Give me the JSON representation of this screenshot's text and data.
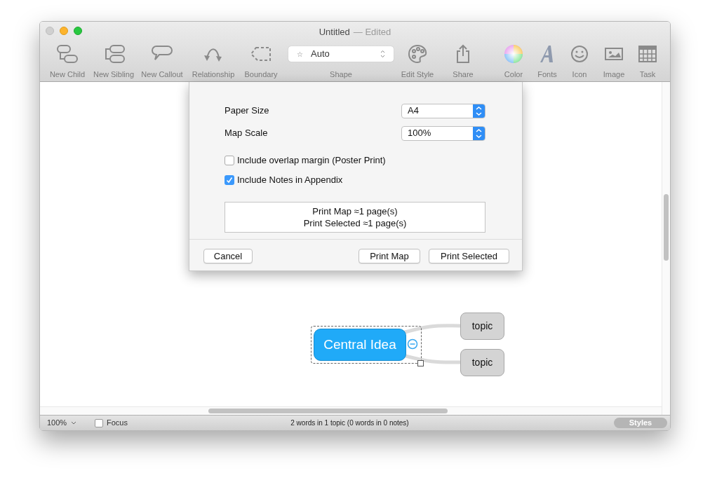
{
  "window": {
    "title": "Untitled",
    "subtitle": "— Edited"
  },
  "toolbar": [
    {
      "kind": "tool",
      "label": "New Child"
    },
    {
      "kind": "tool",
      "label": "New Sibling"
    },
    {
      "kind": "tool",
      "label": "New Callout"
    },
    {
      "kind": "tool",
      "label": "Relationship"
    },
    {
      "kind": "tool",
      "label": "Boundary"
    },
    {
      "kind": "select",
      "label": "Shape",
      "value": "Auto",
      "glyph": "☆"
    },
    {
      "kind": "tool",
      "label": "Edit Style"
    },
    {
      "kind": "tool",
      "label": "Share"
    },
    {
      "kind": "tool",
      "label": "Color"
    },
    {
      "kind": "tool",
      "label": "Fonts"
    },
    {
      "kind": "tool",
      "label": "Icon"
    },
    {
      "kind": "tool",
      "label": "Image"
    },
    {
      "kind": "tool",
      "label": "Task"
    }
  ],
  "dialog": {
    "fields": [
      {
        "label": "Paper Size",
        "value": "A4"
      },
      {
        "label": "Map Scale",
        "value": "100%"
      }
    ],
    "checkboxes": [
      {
        "label": "Include overlap margin (Poster Print)",
        "checked": false
      },
      {
        "label": "Include Notes in Appendix",
        "checked": true
      }
    ],
    "summary": [
      "Print Map ≈1 page(s)",
      "Print Selected ≈1 page(s)"
    ],
    "buttons": [
      "Cancel",
      "Print Map",
      "Print Selected"
    ]
  },
  "map": {
    "central_topic": "Central Idea",
    "topics": [
      "topic",
      "topic"
    ]
  },
  "status_bar": {
    "zoom": "100%",
    "focus": {
      "label": "Focus",
      "checked": false
    },
    "word_count": "2 words in 1 topic (0 words in 0 notes)",
    "styles_button": "Styles"
  }
}
